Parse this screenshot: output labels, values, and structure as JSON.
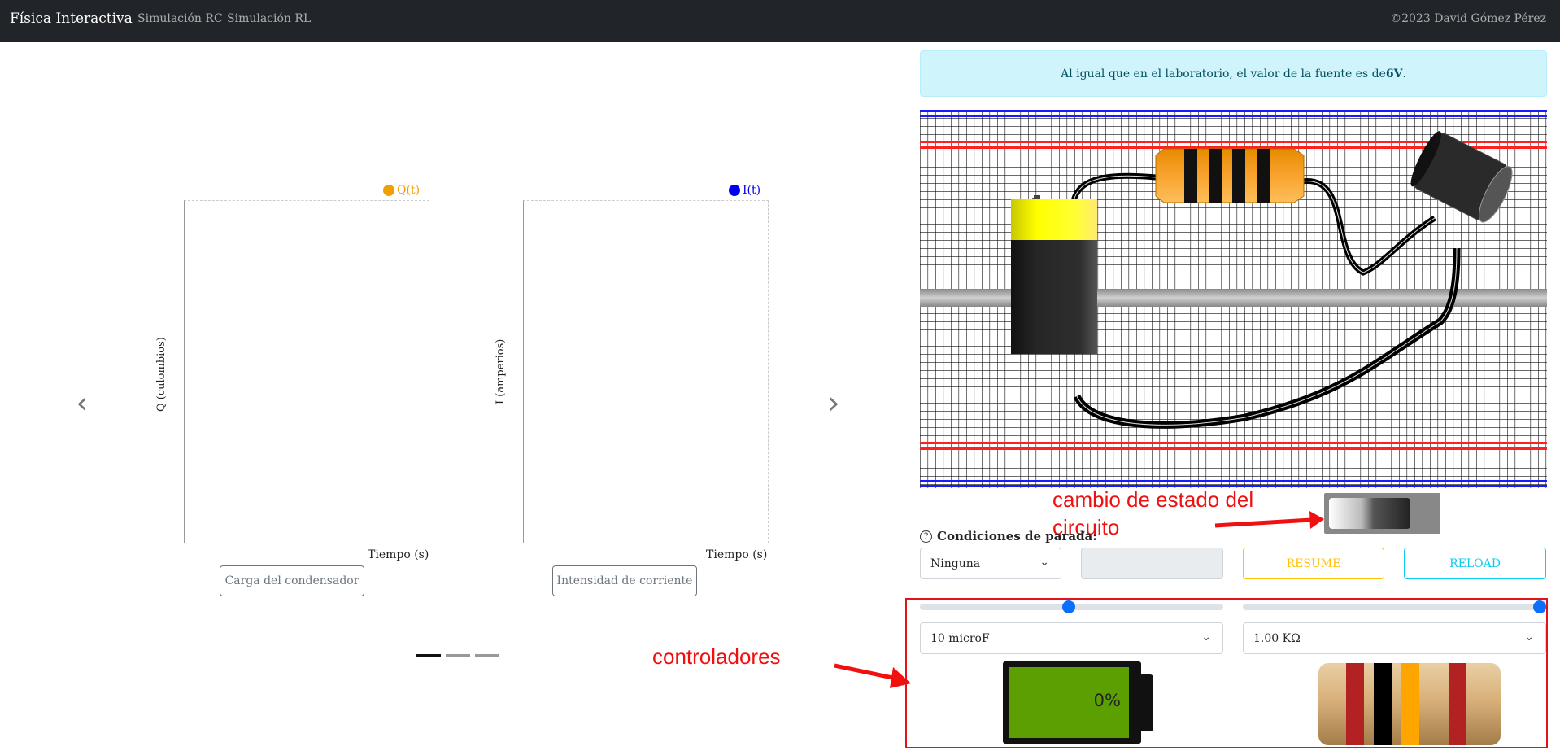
{
  "navbar": {
    "brand": "Física Interactiva",
    "links": [
      "Simulación RC",
      "Simulación RL"
    ],
    "copyright": "©2023 David Gómez Pérez"
  },
  "charts": {
    "charge": {
      "legend": "Q(t)",
      "color": "#f0a000",
      "ylabel": "Q (culombios)",
      "xlabel": "Tiempo (s)",
      "button": "Carga del condensador"
    },
    "current": {
      "legend": "I(t)",
      "color": "#0000ee",
      "ylabel": "I (amperios)",
      "xlabel": "Tiempo (s)",
      "button": "Intensidad de corriente"
    },
    "prev_icon": "chevron-left-icon",
    "next_icon": "chevron-right-icon",
    "active_slide": 1,
    "slides": 3
  },
  "alert": {
    "text": "Al igual que en el laboratorio, el valor de la fuente es de ",
    "value": "6V",
    "end": "."
  },
  "annotations": {
    "switch_note_1": "cambio de estado del",
    "switch_note_2": "circuito",
    "controls_note": "controladores"
  },
  "stop_conditions": {
    "label": "Condiciones de parada:",
    "help_icon": "question-circle-icon",
    "selected": "Ninguna",
    "value": ""
  },
  "buttons": {
    "resume": "RESUME",
    "reload": "RELOAD",
    "resume_color": "#ffc107",
    "reload_color": "#0dcaf0"
  },
  "controls": {
    "capacitance": {
      "selected": "10 microF",
      "slider_fraction": 0.49
    },
    "resistance": {
      "selected": "1.00 KΩ",
      "slider_fraction": 1.0
    },
    "battery_charge": "0%",
    "resistor_bands": [
      "#b22222",
      "#000000",
      "#ffa500",
      "#b22222"
    ]
  }
}
